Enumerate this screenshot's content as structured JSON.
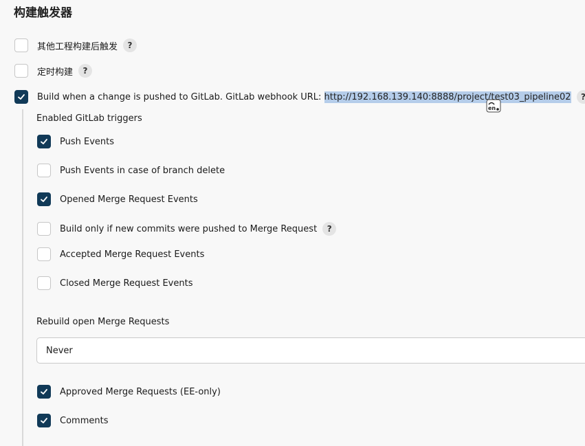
{
  "section_title": "构建触发器",
  "triggers": [
    {
      "label": "其他工程构建后触发",
      "checked": false,
      "help": "?"
    },
    {
      "label": "定时构建",
      "checked": false,
      "help": "?"
    },
    {
      "label": "Build when a change is pushed to GitLab. GitLab webhook URL: ",
      "url": "http://192.168.139.140:8888/project/test03_pipeline02",
      "checked": true,
      "help": "?"
    }
  ],
  "gitlab": {
    "enabled_label": "Enabled GitLab triggers",
    "events": [
      {
        "label": "Push Events",
        "checked": true
      },
      {
        "label": "Push Events in case of branch delete",
        "checked": false
      },
      {
        "label": "Opened Merge Request Events",
        "checked": true
      },
      {
        "label": "Build only if new commits were pushed to Merge Request",
        "checked": false,
        "help": "?"
      },
      {
        "label": "Accepted Merge Request Events",
        "checked": false
      },
      {
        "label": "Closed Merge Request Events",
        "checked": false
      }
    ],
    "rebuild_label": "Rebuild open Merge Requests",
    "rebuild_value": "Never",
    "extra": [
      {
        "label": "Approved Merge Requests (EE-only)",
        "checked": true
      },
      {
        "label": "Comments",
        "checked": true
      }
    ]
  },
  "ime_badge": "en",
  "colors": {
    "checked": "#113a58",
    "selection": "#b5cdea"
  }
}
